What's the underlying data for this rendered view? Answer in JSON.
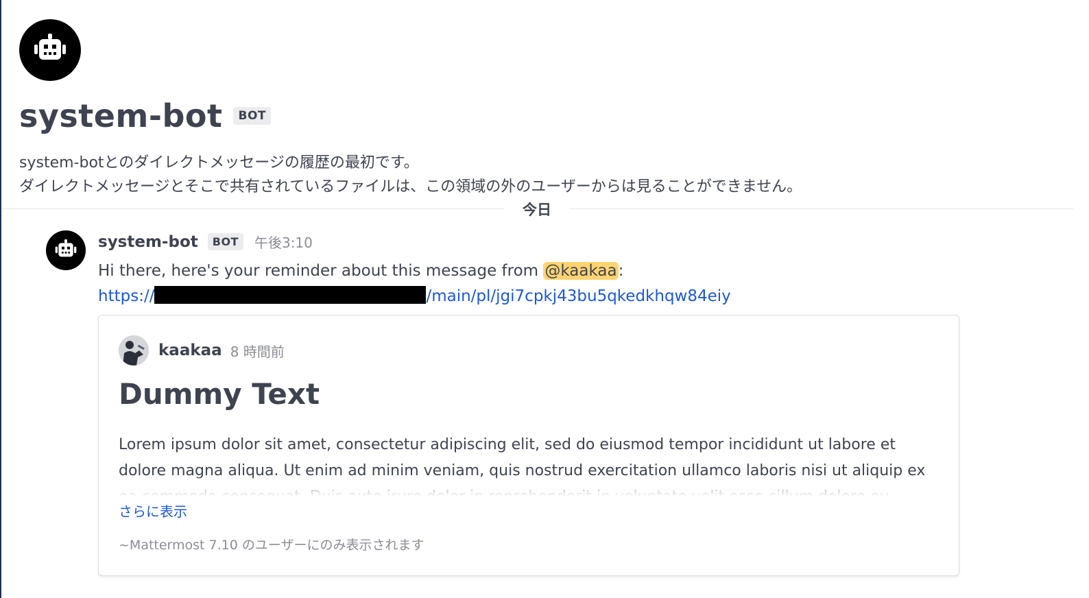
{
  "channel_intro": {
    "name": "system-bot",
    "bot_tag": "BOT",
    "line1": "system-botとのダイレクトメッセージの履歴の最初です。",
    "line2": "ダイレクトメッセージとそこで共有されているファイルは、この領域の外のユーザーからは見ることができません。"
  },
  "date_separator": "今日",
  "post": {
    "username": "system-bot",
    "bot_tag": "BOT",
    "time": "午後3:10",
    "message_prefix": "Hi there, here's your reminder about this message from ",
    "mention": "@kaakaa",
    "message_suffix": ":",
    "link_start": "https://",
    "link_end": "/main/pl/jgi7cpkj43bu5qkedkhqw84eiy"
  },
  "permalink_card": {
    "username": "kaakaa",
    "time": "8 時間前",
    "title": "Dummy Text",
    "body": "Lorem ipsum dolor sit amet, consectetur adipiscing elit, sed do eiusmod tempor incididunt ut labore et dolore magna aliqua. Ut enim ad minim veniam, quis nostrud exercitation ullamco laboris nisi ut aliquip ex ea commodo consequat. Duis aute irure dolor in reprehenderit in voluptate velit esse cillum dolore eu",
    "show_more": "さらに表示",
    "footer": "~Mattermost 7.10 のユーザーにのみ表示されます"
  },
  "colors": {
    "accent_link": "#1c58d9",
    "mention_highlight": "#ffd470",
    "text": "#3f4350"
  },
  "icons": {
    "bot_avatar": "robot-icon"
  }
}
